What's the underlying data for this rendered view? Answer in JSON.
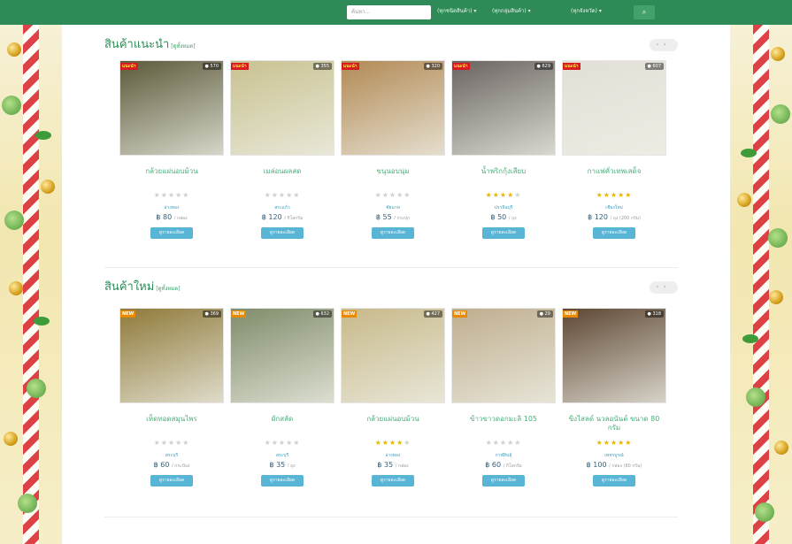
{
  "search": {
    "placeholder": "ค้นหา..."
  },
  "filters": {
    "category": "(ทุกชนิดสินค้า)",
    "group": "(ทุกกลุ่มสินค้า)",
    "province": "(ทุกจังหวัด)"
  },
  "search_button": {
    "icon": "search-icon",
    "glyph": "⌕"
  },
  "sections": [
    {
      "title": "สินค้าแนะนำ",
      "view_all": "[ดูทั้งหมด]",
      "products": [
        {
          "name": "กล้วยแผ่นอบม้วน",
          "views": "570",
          "tag": "แนะนำ",
          "rating": 0,
          "province": "อ่างทอง",
          "price": "฿ 80",
          "unit": "/ กล่อง",
          "button": "ดูรายละเอียด",
          "photo": "#5c5a3a"
        },
        {
          "name": "เมล่อนผลสด",
          "views": "355",
          "tag": "แนะนำ",
          "rating": 0,
          "province": "สระแก้ว",
          "price": "฿ 120",
          "unit": "/ กิโลกรัม",
          "button": "ดูรายละเอียด",
          "photo": "#c8c290"
        },
        {
          "name": "ขนุนอบนุ่ม",
          "views": "320",
          "tag": "แนะนำ",
          "rating": 0,
          "province": "ชัยนาท",
          "price": "฿ 55",
          "unit": "/ กระปุก",
          "button": "ดูรายละเอียด",
          "photo": "#b28a55"
        },
        {
          "name": "น้ำพริกกุ้งเสียบ",
          "views": "629",
          "tag": "แนะนำ",
          "rating": 4,
          "province": "ปราจีนบุรี",
          "price": "฿ 50",
          "unit": "/ ถุง",
          "button": "ดูรายละเอียด",
          "photo": "#6a6460"
        },
        {
          "name": "กาแฟคั่วเทพเสด็จ",
          "views": "607",
          "tag": "แนะนำ",
          "rating": 5,
          "province": "เชียงใหม่",
          "price": "฿ 120",
          "unit": "/ ถุง (200 กรัม)",
          "button": "ดูรายละเอียด",
          "photo": "#e2dfd6"
        }
      ]
    },
    {
      "title": "สินค้าใหม่",
      "view_all": "[ดูทั้งหมด]",
      "products": [
        {
          "name": "เห็ดทอดสมุนไพร",
          "views": "369",
          "tag": "NEW",
          "rating": 0,
          "province": "สระบุรี",
          "price": "฿ 60",
          "unit": "/ กระป๋อง",
          "button": "ดูรายละเอียด",
          "photo": "#8f7a3a"
        },
        {
          "name": "ผักสลัด",
          "views": "632",
          "tag": "NEW",
          "rating": 0,
          "province": "สระบุรี",
          "price": "฿ 35",
          "unit": "/ ถุง",
          "button": "ดูรายละเอียด",
          "photo": "#7f8c6a"
        },
        {
          "name": "กล้วยแผ่นอบม้วน",
          "views": "427",
          "tag": "NEW",
          "rating": 4,
          "province": "อ่างทอง",
          "price": "฿ 35",
          "unit": "/ กล่อง",
          "button": "ดูรายละเอียด",
          "photo": "#c7b98a"
        },
        {
          "name": "ข้าวขาวดอกมะลิ 105",
          "views": "29",
          "tag": "NEW",
          "rating": 0,
          "province": "กาฬสินธุ์",
          "price": "฿ 60",
          "unit": "/ กิโลกรัม",
          "button": "ดูรายละเอียด",
          "photo": "#bfae8e"
        },
        {
          "name": "ขิงไสลด์ นวลอนันต์ ขนาด 80 กรัม",
          "views": "318",
          "tag": "NEW",
          "rating": 5,
          "province": "เพชรบูรณ์",
          "price": "฿ 100",
          "unit": "/ กล่อง (80 กรัม)",
          "button": "ดูรายละเอียด",
          "photo": "#5e4733"
        }
      ]
    }
  ],
  "colors": {
    "brand": "#2e8b57",
    "button": "#58b5d6",
    "star": "#e6b800"
  }
}
